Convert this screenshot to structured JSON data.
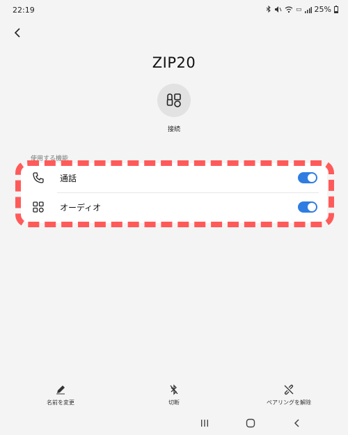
{
  "status_bar": {
    "time": "22:19",
    "battery": "25%"
  },
  "header": {
    "device_name": "ZIP20"
  },
  "connect": {
    "label": "接続"
  },
  "features": {
    "section_label": "使用する機能",
    "items": [
      {
        "label": "通話",
        "icon": "phone-icon",
        "enabled": true
      },
      {
        "label": "オーディオ",
        "icon": "grid-icon",
        "enabled": true
      }
    ]
  },
  "bottom_actions": [
    {
      "label": "名前を変更",
      "icon": "pencil-icon"
    },
    {
      "label": "切断",
      "icon": "bluetooth-off-icon"
    },
    {
      "label": "ペアリングを解除",
      "icon": "unlink-icon"
    }
  ],
  "colors": {
    "accent": "#2f7de1",
    "highlight": "#ff5a5a",
    "background": "#f4f4f4"
  }
}
